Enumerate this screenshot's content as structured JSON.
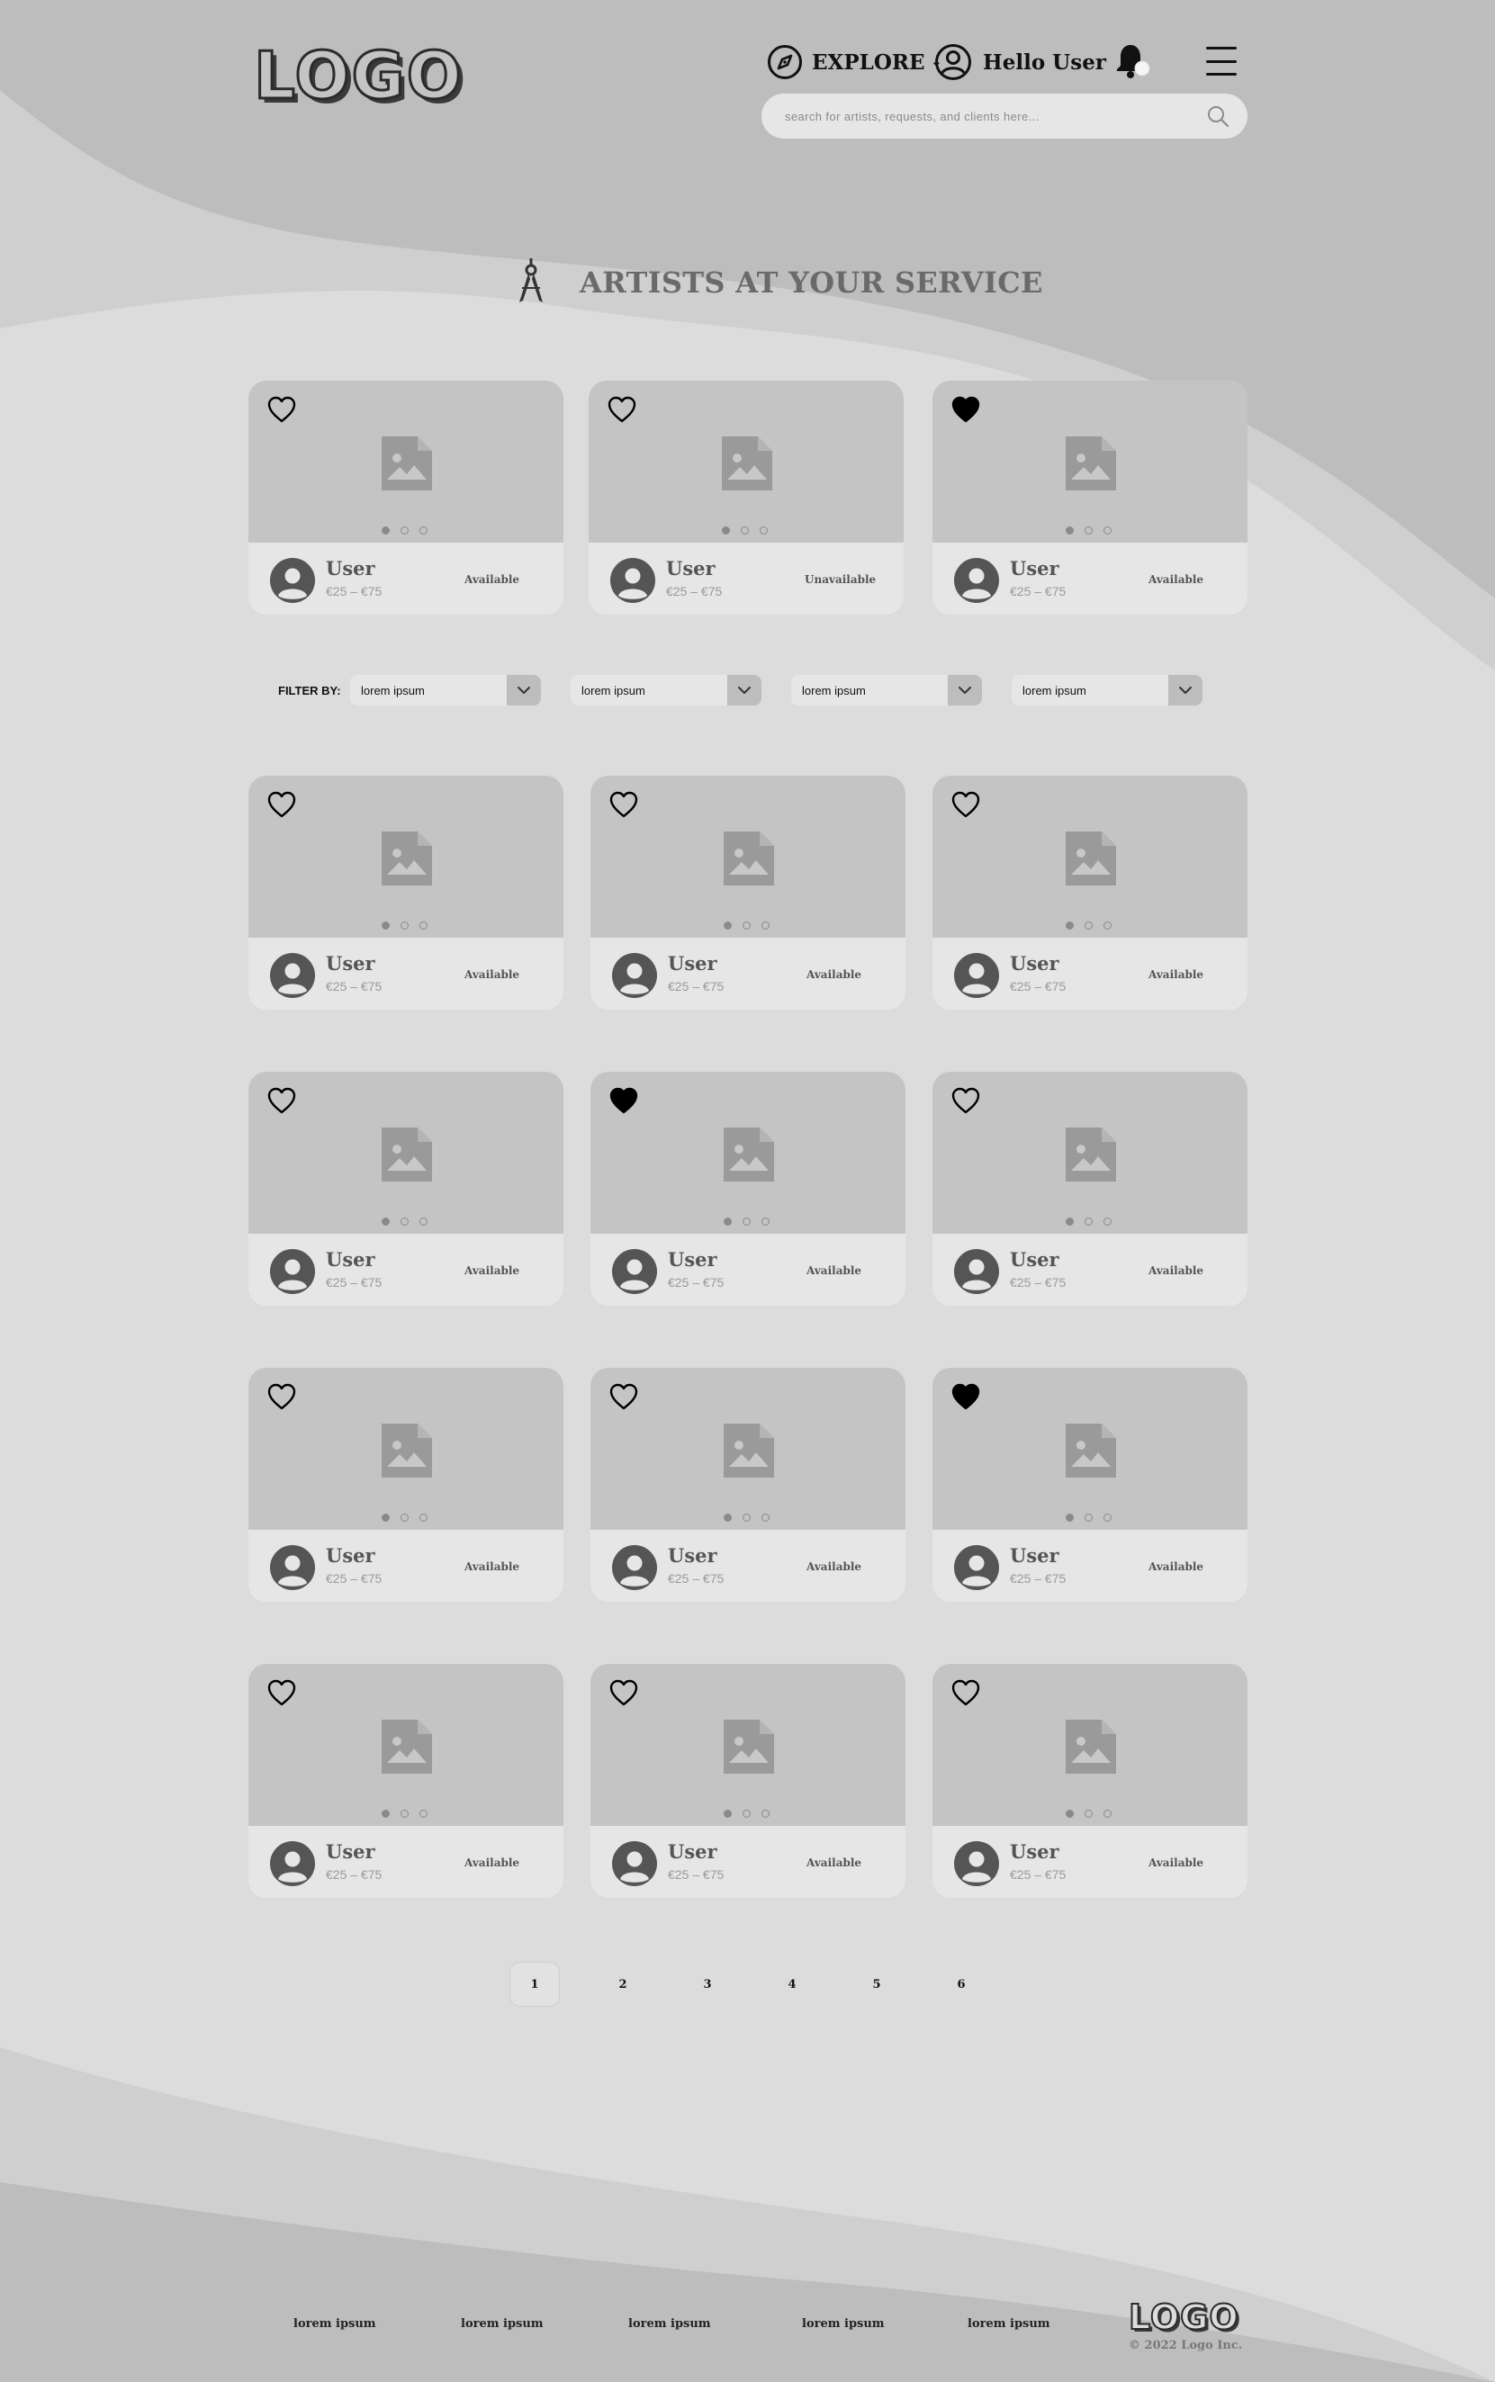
{
  "header": {
    "logo": "LOGO",
    "explore": "EXPLORE",
    "explore_caret": "⌄",
    "greeting": "Hello User",
    "search_placeholder": "search for artists, requests, and clients here..."
  },
  "section": {
    "title": "ARTISTS AT YOUR SERVICE"
  },
  "featured": [
    {
      "name": "User",
      "price": "€25 – €75",
      "status": "Available",
      "favorited": false
    },
    {
      "name": "User",
      "price": "€25 – €75",
      "status": "Unavailable",
      "favorited": false
    },
    {
      "name": "User",
      "price": "€25 – €75",
      "status": "Available",
      "favorited": true
    }
  ],
  "filters": {
    "label": "FILTER BY:",
    "options": [
      "lorem ipsum",
      "lorem ipsum",
      "lorem ipsum",
      "lorem ipsum"
    ]
  },
  "grid": [
    {
      "name": "User",
      "price": "€25 – €75",
      "status": "Available",
      "favorited": false
    },
    {
      "name": "User",
      "price": "€25 – €75",
      "status": "Available",
      "favorited": false
    },
    {
      "name": "User",
      "price": "€25 – €75",
      "status": "Available",
      "favorited": false
    },
    {
      "name": "User",
      "price": "€25 – €75",
      "status": "Available",
      "favorited": false
    },
    {
      "name": "User",
      "price": "€25 – €75",
      "status": "Available",
      "favorited": true
    },
    {
      "name": "User",
      "price": "€25 – €75",
      "status": "Available",
      "favorited": false
    },
    {
      "name": "User",
      "price": "€25 – €75",
      "status": "Available",
      "favorited": false
    },
    {
      "name": "User",
      "price": "€25 – €75",
      "status": "Available",
      "favorited": false
    },
    {
      "name": "User",
      "price": "€25 – €75",
      "status": "Available",
      "favorited": true
    },
    {
      "name": "User",
      "price": "€25 – €75",
      "status": "Available",
      "favorited": false
    },
    {
      "name": "User",
      "price": "€25 – €75",
      "status": "Available",
      "favorited": false
    },
    {
      "name": "User",
      "price": "€25 – €75",
      "status": "Available",
      "favorited": false
    }
  ],
  "pagination": {
    "pages": [
      "1",
      "2",
      "3",
      "4",
      "5",
      "6"
    ],
    "current": "1"
  },
  "footer": {
    "links": [
      "lorem ipsum",
      "lorem ipsum",
      "lorem ipsum",
      "lorem ipsum",
      "lorem ipsum"
    ],
    "logo": "LOGO",
    "copyright": "© 2022 Logo Inc."
  },
  "colors": {
    "page_bg": "#dcdcdc",
    "wave_dark": "#bdbdbd",
    "wave_mid": "#cfcfcf",
    "card_image": "#c4c4c4",
    "card_body": "#e6e6e6",
    "text_muted": "#6a6a6a"
  },
  "icons": [
    "compass-icon",
    "user-circle-icon",
    "bell-icon",
    "menu-icon",
    "search-icon",
    "compass-tool-icon",
    "heart-icon",
    "image-placeholder-icon",
    "avatar-icon",
    "chevron-down-icon"
  ]
}
